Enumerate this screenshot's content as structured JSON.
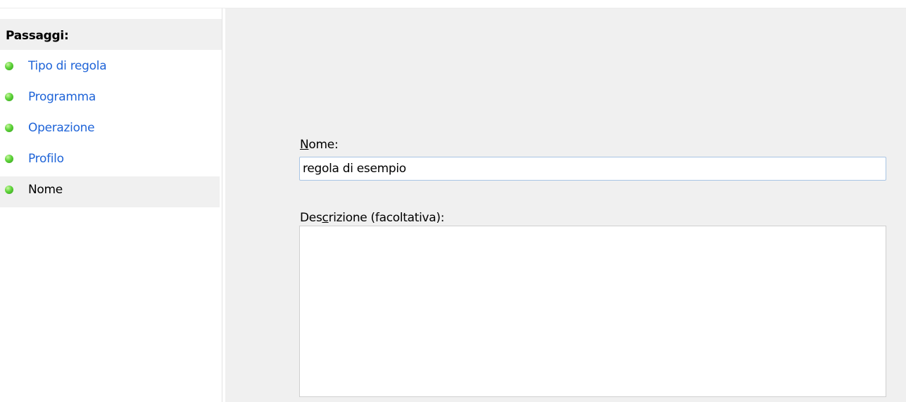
{
  "steps": {
    "header": "Passaggi:",
    "items": [
      {
        "label": "Tipo di regola",
        "selected": false
      },
      {
        "label": "Programma",
        "selected": false
      },
      {
        "label": "Operazione",
        "selected": false
      },
      {
        "label": "Profilo",
        "selected": false
      },
      {
        "label": "Nome",
        "selected": true
      }
    ],
    "bullet_icon": "green-dot-icon",
    "link_color": "#1f64d8"
  },
  "form": {
    "name_label_prefix": "N",
    "name_label_rest": "ome:",
    "name_value": "regola di esempio",
    "desc_label_pre": "Des",
    "desc_label_ul": "c",
    "desc_label_rest": "rizione (facoltativa):",
    "desc_value": ""
  }
}
